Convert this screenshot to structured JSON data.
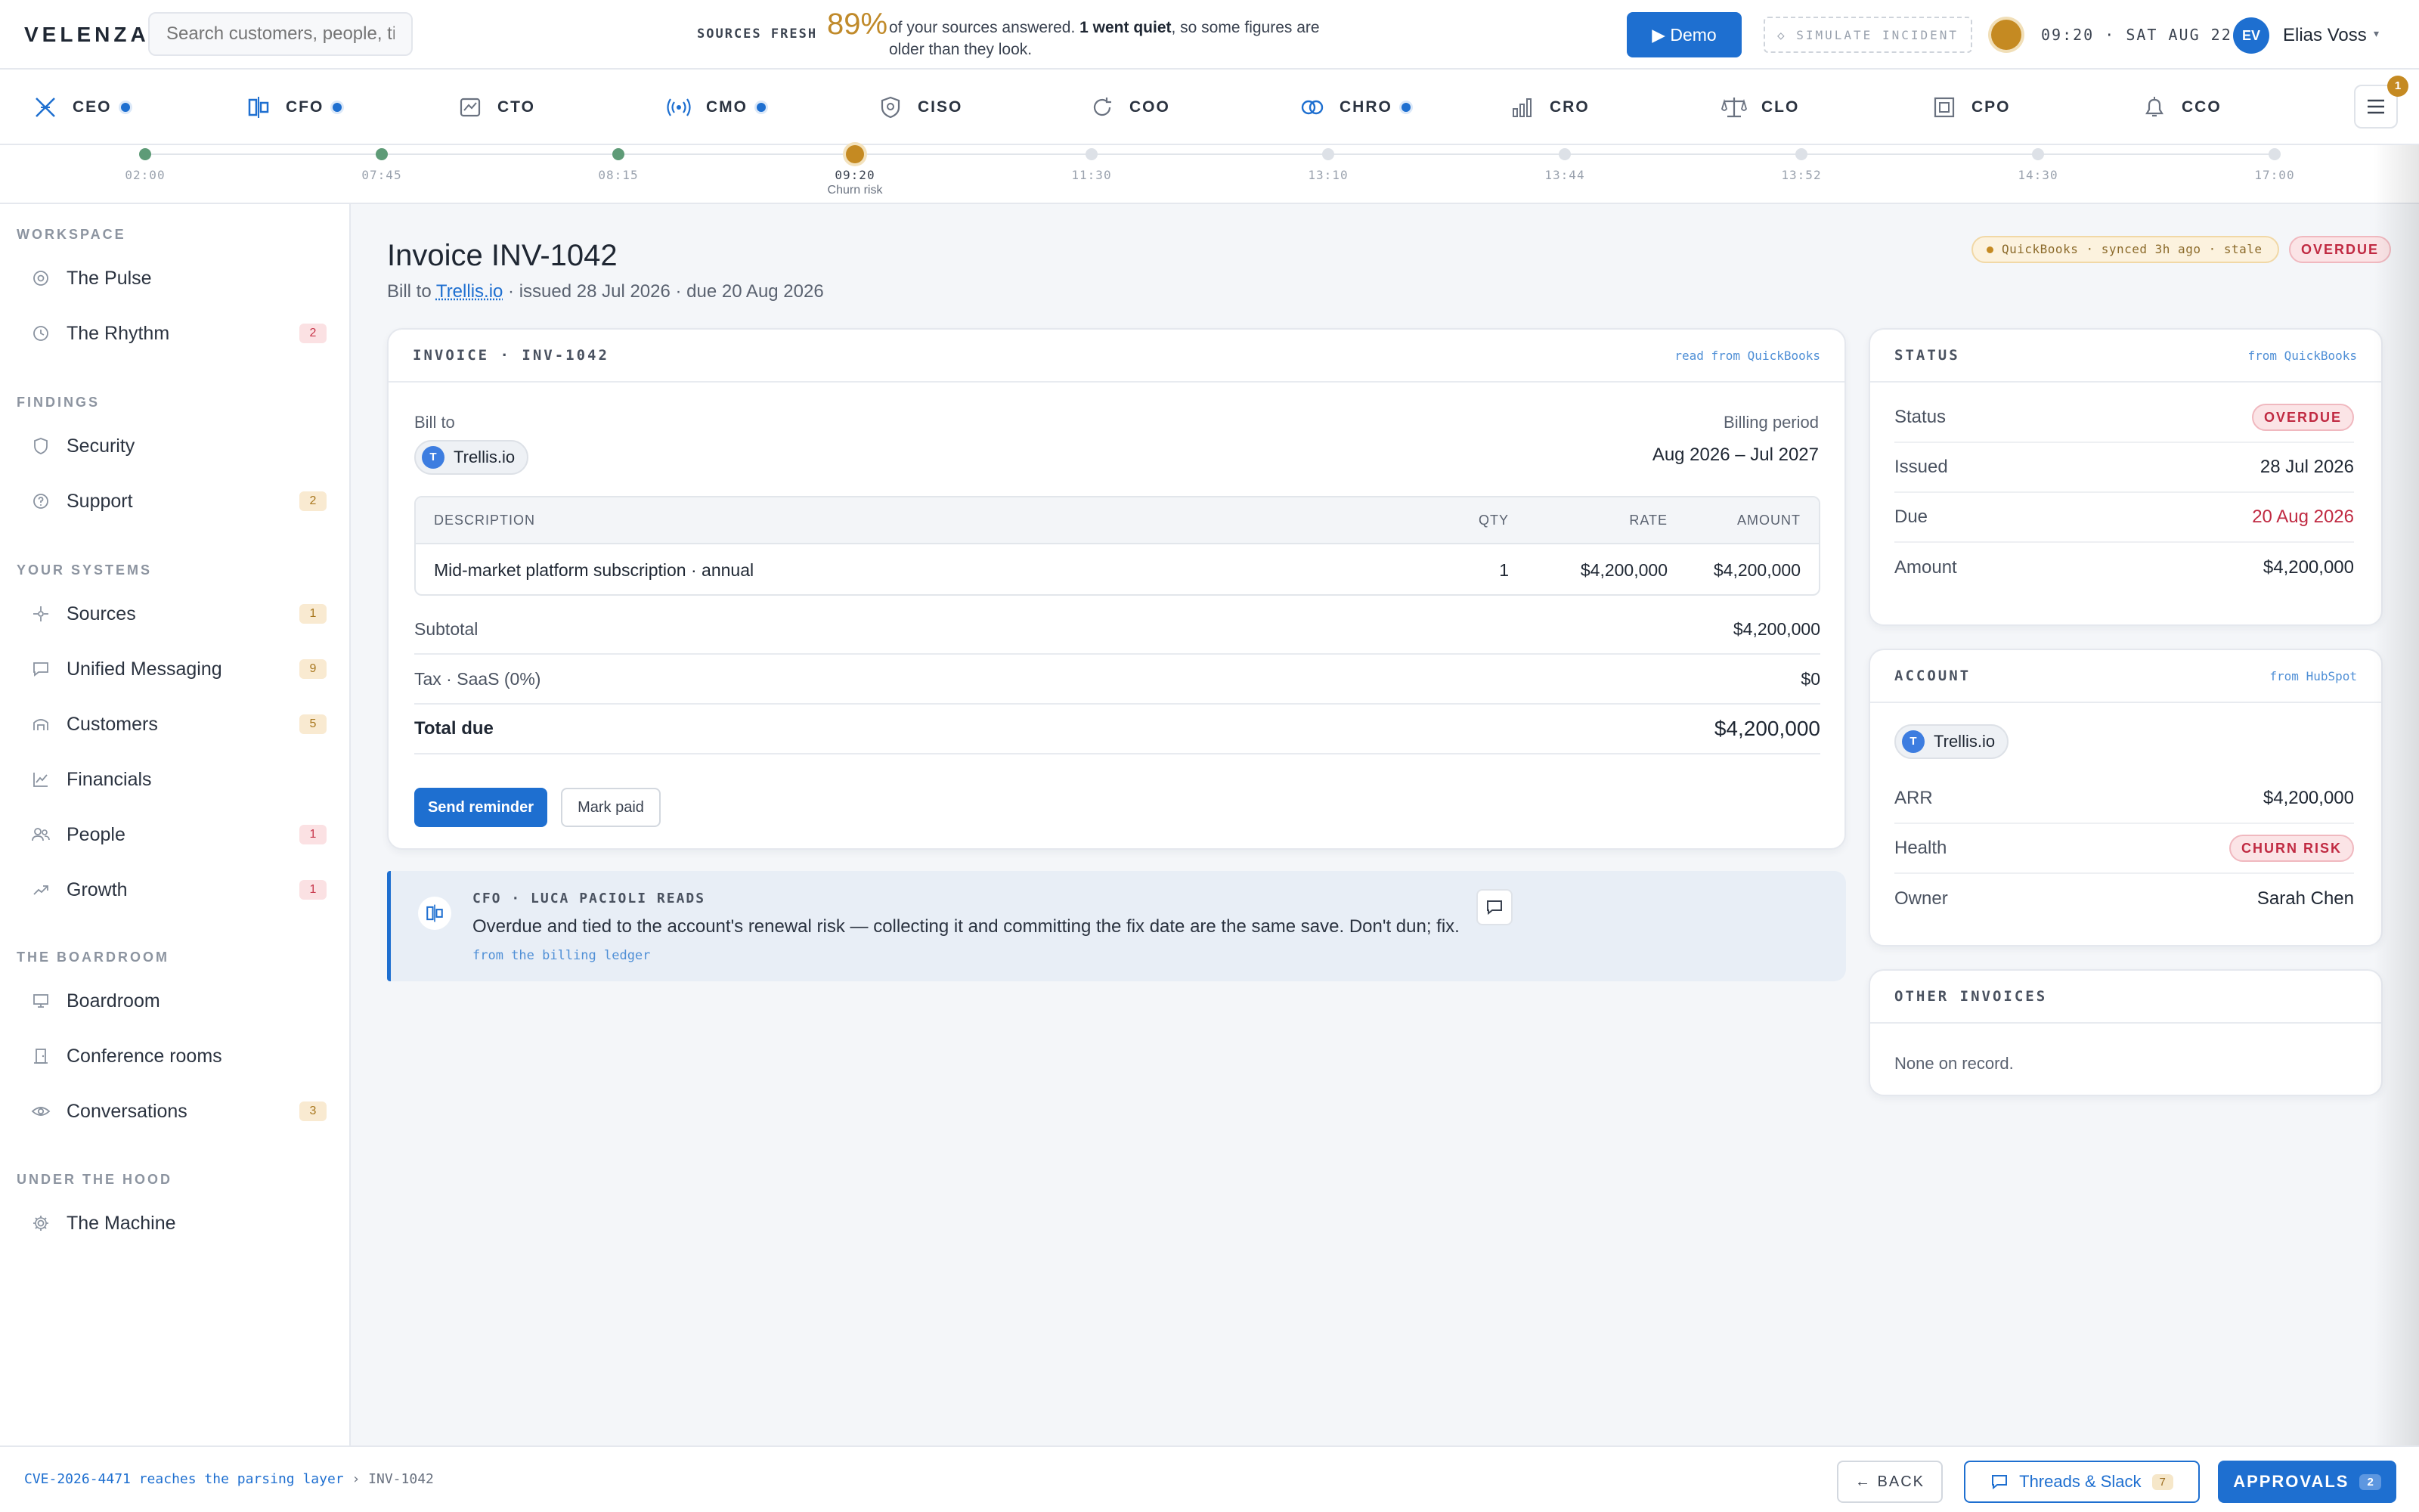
{
  "brand": "VELENZA.",
  "search": {
    "placeholder": "Search customers, people, ti"
  },
  "freshness": {
    "label": "SOURCES FRESH",
    "pct": "89%",
    "text_a": "of your sources answered.",
    "text_b": "1 went quiet",
    "text_c": ", so some figures are older than they look."
  },
  "topbar": {
    "demo_label": "Demo",
    "simulate_label": "SIMULATE INCIDENT",
    "clock": "09:20 · SAT AUG 22",
    "user_initials": "EV",
    "user_name": "Elias Voss"
  },
  "execs": [
    {
      "label": "CEO",
      "icon": "ceo-icon",
      "dot": true
    },
    {
      "label": "CFO",
      "icon": "cfo-icon",
      "dot": true
    },
    {
      "label": "CTO",
      "icon": "cto-icon",
      "dot": false
    },
    {
      "label": "CMO",
      "icon": "cmo-icon",
      "dot": true
    },
    {
      "label": "CISO",
      "icon": "shield-icon",
      "dot": false
    },
    {
      "label": "COO",
      "icon": "refresh-icon",
      "dot": false
    },
    {
      "label": "CHRO",
      "icon": "rings-icon",
      "dot": true
    },
    {
      "label": "CRO",
      "icon": "bar-chart-icon",
      "dot": false
    },
    {
      "label": "CLO",
      "icon": "scales-icon",
      "dot": false
    },
    {
      "label": "CPO",
      "icon": "square-icon",
      "dot": false
    },
    {
      "label": "CCO",
      "icon": "bell-icon",
      "dot": false
    }
  ],
  "menu_badge": "1",
  "timeline": [
    {
      "time": "02:00",
      "state": "done"
    },
    {
      "time": "07:45",
      "state": "done"
    },
    {
      "time": "08:15",
      "state": "done"
    },
    {
      "time": "09:20",
      "state": "now",
      "sub": "Churn risk"
    },
    {
      "time": "11:30",
      "state": "future"
    },
    {
      "time": "13:10",
      "state": "future"
    },
    {
      "time": "13:44",
      "state": "future"
    },
    {
      "time": "13:52",
      "state": "future"
    },
    {
      "time": "14:30",
      "state": "future"
    },
    {
      "time": "17:00",
      "state": "future"
    }
  ],
  "sidebar": {
    "workspace": "WORKSPACE",
    "findings": "FINDINGS",
    "systems": "YOUR SYSTEMS",
    "boardroom": "THE BOARDROOM",
    "hood": "UNDER THE HOOD",
    "items": {
      "pulse": {
        "label": "The Pulse"
      },
      "rhythm": {
        "label": "The Rhythm",
        "badge": "2"
      },
      "security": {
        "label": "Security"
      },
      "support": {
        "label": "Support",
        "badge": "2"
      },
      "sources": {
        "label": "Sources",
        "badge": "1"
      },
      "messaging": {
        "label": "Unified Messaging",
        "badge": "9"
      },
      "customers": {
        "label": "Customers",
        "badge": "5"
      },
      "financials": {
        "label": "Financials"
      },
      "people": {
        "label": "People",
        "badge": "1"
      },
      "growth": {
        "label": "Growth",
        "badge": "1"
      },
      "boardroom": {
        "label": "Boardroom"
      },
      "conference": {
        "label": "Conference rooms"
      },
      "conversations": {
        "label": "Conversations",
        "badge": "3"
      },
      "machine": {
        "label": "The Machine"
      }
    }
  },
  "page": {
    "title": "Invoice INV-1042",
    "sub_prefix": "Bill to",
    "sub_link": "Trellis.io",
    "sub_suffix": "· issued 28 Jul 2026 · due 20 Aug 2026",
    "sync_pill": "QuickBooks · synced 3h ago · stale",
    "status_pill": "OVERDUE"
  },
  "invoice": {
    "head": "INVOICE · INV-1042",
    "source": "read from QuickBooks",
    "bill_to_label": "Bill to",
    "customer_initial": "T",
    "customer": "Trellis.io",
    "period_label": "Billing period",
    "period": "Aug 2026 – Jul 2027",
    "columns": {
      "desc": "DESCRIPTION",
      "qty": "QTY",
      "rate": "RATE",
      "amount": "AMOUNT"
    },
    "line": {
      "desc": "Mid-market platform subscription · annual",
      "qty": "1",
      "rate": "$4,200,000",
      "amount": "$4,200,000"
    },
    "subtotal_label": "Subtotal",
    "subtotal": "$4,200,000",
    "tax_label": "Tax · SaaS (0%)",
    "tax": "$0",
    "total_label": "Total due",
    "total": "$4,200,000",
    "remind_label": "Send reminder",
    "paid_label": "Mark paid"
  },
  "note": {
    "who": "CFO · LUCA PACIOLI READS",
    "text": "Overdue and tied to the account's renewal risk — collecting it and committing the fix date are the same save. Don't dun; fix.",
    "source": "from the billing ledger"
  },
  "status_card": {
    "head": "STATUS",
    "source": "from QuickBooks",
    "status_label": "Status",
    "status": "OVERDUE",
    "issued_label": "Issued",
    "issued": "28 Jul 2026",
    "due_label": "Due",
    "due": "20 Aug 2026",
    "amount_label": "Amount",
    "amount": "$4,200,000"
  },
  "account_card": {
    "head": "ACCOUNT",
    "source": "from HubSpot",
    "initial": "T",
    "name": "Trellis.io",
    "arr_label": "ARR",
    "arr": "$4,200,000",
    "health_label": "Health",
    "health": "CHURN RISK",
    "owner_label": "Owner",
    "owner": "Sarah Chen"
  },
  "other_card": {
    "head": "OTHER INVOICES",
    "empty": "None on record."
  },
  "footer": {
    "crumb_link": "CVE-2026-4471 reaches the parsing layer",
    "crumb_sep": "›",
    "crumb_current": "INV-1042",
    "back_label": "← BACK",
    "threads_label": "Threads & Slack",
    "threads_count": "7",
    "approvals_label": "APPROVALS",
    "approvals_count": "2"
  },
  "colors": {
    "accent": "#1e6fd0",
    "amber": "#c58a22",
    "danger": "#c02a42",
    "done": "#5e9b77"
  }
}
